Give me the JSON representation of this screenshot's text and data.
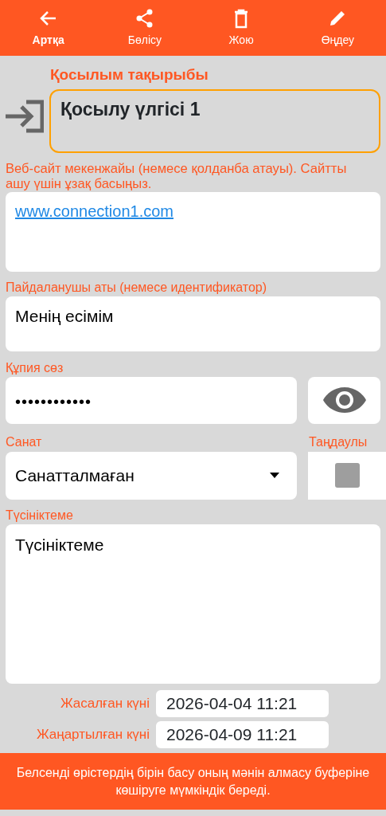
{
  "toolbar": [
    {
      "label": "Артқа",
      "kind": "back",
      "selected": true
    },
    {
      "label": "Бөлісу",
      "kind": "share",
      "selected": false
    },
    {
      "label": "Жою",
      "kind": "delete",
      "selected": false
    },
    {
      "label": "Өңдеу",
      "kind": "edit",
      "selected": false
    }
  ],
  "title_field": {
    "label": "Қосылым тақырыбы",
    "value": "Қосылу үлгісі 1",
    "focused": true
  },
  "url_field": {
    "label": "Веб-сайт мекенжайы (немесе қолданба атауы). Сайтты ашу үшін ұзақ басыңыз.",
    "value": "www.connection1.com"
  },
  "username_field": {
    "label": "Пайдаланушы аты (немесе идентификатор)",
    "value": "Менің есімім"
  },
  "password_field": {
    "label": "Құпия сөз",
    "value": "••••••••••••"
  },
  "category": {
    "label": "Санат",
    "value": "Санатталмаған"
  },
  "favorite": {
    "label": "Таңдаулы",
    "checked": false
  },
  "comment_field": {
    "label": "Түсініктеме",
    "value": "Түсініктеме"
  },
  "dates": [
    {
      "label": "Жасалған күні",
      "value": "2026-04-04 11:21"
    },
    {
      "label": "Жаңартылған күні",
      "value": "2026-04-09 11:21"
    }
  ],
  "footer": "Белсенді өрістердің бірін басу оның мәнін алмасу буферіне көшіруге мүмкіндік береді."
}
